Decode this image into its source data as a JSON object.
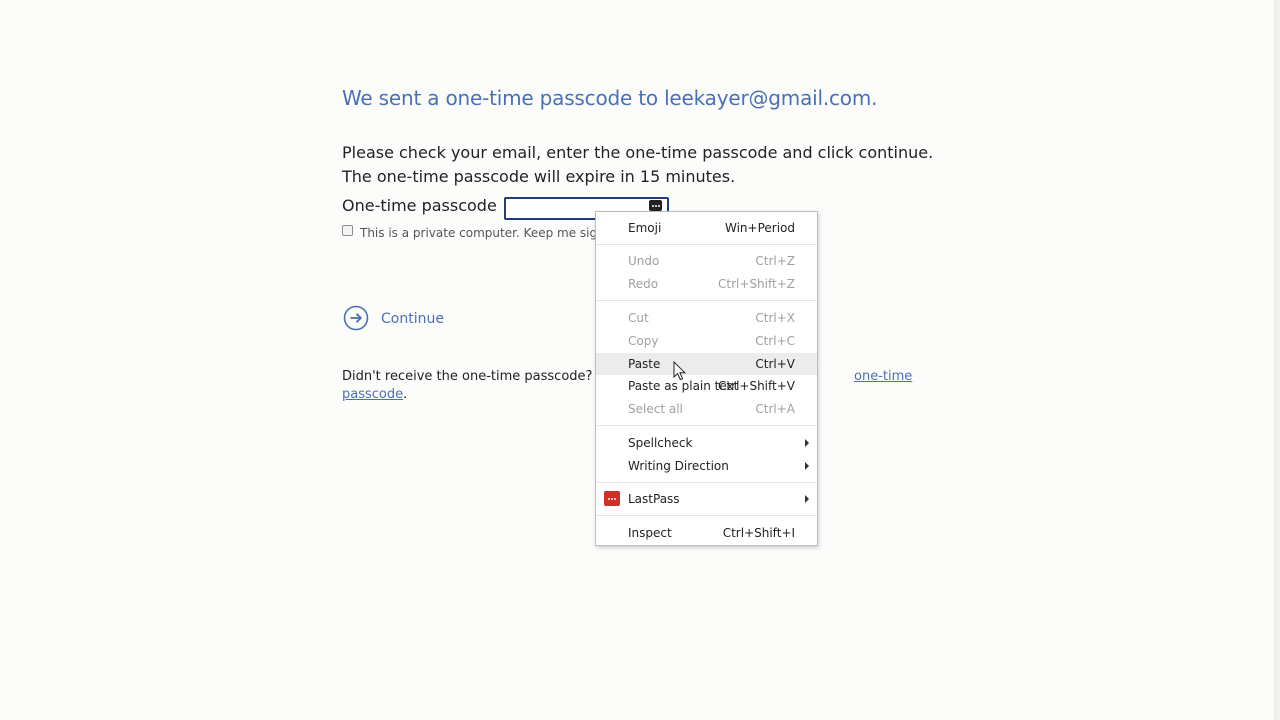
{
  "page": {
    "heading": "We sent a one-time passcode to leekayer@gmail.com.",
    "instructions": {
      "line1": "Please check your email, enter the one-time passcode and click continue.",
      "line2": "The one-time passcode will expire in 15 minutes."
    },
    "otp_label": "One-time passcode",
    "otp_value": "",
    "keep_signed_in_label": "This is a private computer. Keep me signed",
    "continue_label": "Continue",
    "didnt_receive_text": "Didn't receive the one-time passcode? Ch",
    "resend_link_part1": "one-time",
    "resend_link_part2": "passcode",
    "resend_trailing": "."
  },
  "context_menu": {
    "emoji": {
      "label": "Emoji",
      "shortcut": "Win+Period"
    },
    "undo": {
      "label": "Undo",
      "shortcut": "Ctrl+Z"
    },
    "redo": {
      "label": "Redo",
      "shortcut": "Ctrl+Shift+Z"
    },
    "cut": {
      "label": "Cut",
      "shortcut": "Ctrl+X"
    },
    "copy": {
      "label": "Copy",
      "shortcut": "Ctrl+C"
    },
    "paste": {
      "label": "Paste",
      "shortcut": "Ctrl+V"
    },
    "paste_plain": {
      "label": "Paste as plain text",
      "shortcut": "Ctrl+Shift+V"
    },
    "select_all": {
      "label": "Select all",
      "shortcut": "Ctrl+A"
    },
    "spellcheck": {
      "label": "Spellcheck"
    },
    "writing_direction": {
      "label": "Writing Direction"
    },
    "lastpass": {
      "label": "LastPass"
    },
    "inspect": {
      "label": "Inspect",
      "shortcut": "Ctrl+Shift+I"
    }
  },
  "colors": {
    "heading": "#4a70b5",
    "link": "#4a70b5",
    "lastpass_red": "#d32d27",
    "input_border": "#1d3f7a",
    "menu_hover": "#ececec"
  }
}
